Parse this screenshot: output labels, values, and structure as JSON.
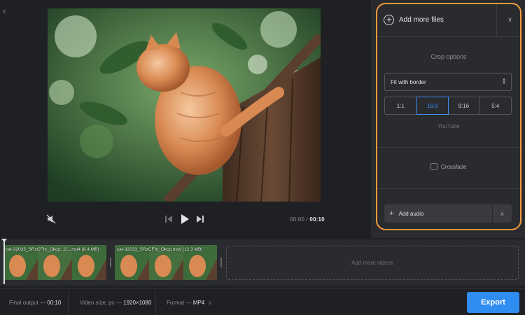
{
  "app": {
    "accent_color": "#2f8cf0",
    "highlight_color": "#f39a3c"
  },
  "player": {
    "back_icon": "chevron-left-icon",
    "time_current": "00:00",
    "time_separator": "/",
    "time_total": "00:10"
  },
  "panel": {
    "add_files_label": "Add more files",
    "crop_title": "Crop options",
    "crop_mode": "Fit with border",
    "ratios": [
      "1:1",
      "16:9",
      "9:16",
      "5:4"
    ],
    "active_ratio": "16:9",
    "ratio_hint": "YouTube",
    "crossfade_label": "Crossfade",
    "crossfade_checked": false,
    "add_audio_label": "Add audio"
  },
  "timeline": {
    "clips": [
      {
        "caption": "cat-32033_SRzCFhr_Okcp...2....mp4 (8.4 MB)"
      },
      {
        "caption": "cat-32033_SRzCFhr_Okcp.mov (12.3 MB)"
      }
    ],
    "add_videos_label": "Add more videos"
  },
  "bottom": {
    "final_output_label": "Final output —",
    "final_output_value": "00:10",
    "video_size_label": "Video size, px —",
    "video_size_value": "1920×1080",
    "format_label": "Format —",
    "format_value": "MP4",
    "export_label": "Export"
  }
}
